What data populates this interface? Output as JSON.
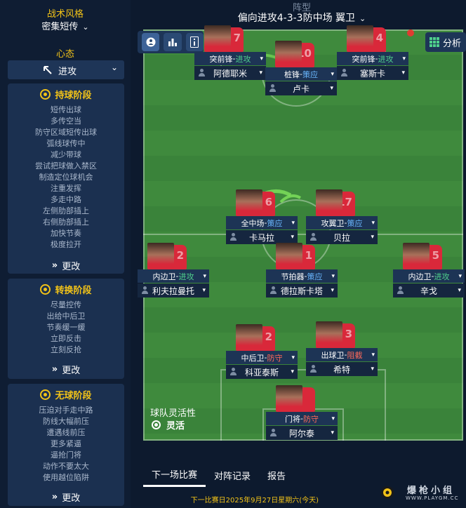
{
  "left_panel": {
    "style_title": "战术风格",
    "style_value": "密集短传",
    "mentality_title": "心态",
    "mentality_value": "进攻",
    "in_possession": {
      "title": "持球阶段",
      "items": [
        "短传出球",
        "多传空当",
        "防守区域短传出球",
        "弧线球传中",
        "减少带球",
        "尝试把球做入禁区",
        "制造定位球机会",
        "注重发挥",
        "多走中路",
        "左侧肋部插上",
        "右侧肋部插上",
        "加快节奏",
        "极度拉开"
      ],
      "button": "更改"
    },
    "transition": {
      "title": "转换阶段",
      "items": [
        "尽量控传",
        "出给中后卫",
        "节奏缓一缓",
        "立即反击",
        "立刻反抢"
      ],
      "button": "更改"
    },
    "out_of_possession": {
      "title": "无球阶段",
      "items": [
        "压迫对手走中路",
        "防线大幅前压",
        "遭遇线前压",
        "更多紧逼",
        "逼抢门将",
        "动作不要太大",
        "使用越位陷阱"
      ],
      "button": "更改"
    }
  },
  "header": {
    "formation_label": "阵型",
    "formation_value": "偏向进攻4-3-3防中场 翼卫"
  },
  "toolbar": {
    "analysis_label": "分析"
  },
  "players": [
    {
      "id": "lf",
      "role": "突前锋",
      "duty": "进攻",
      "duty_type": "attack",
      "name": "阿德耶米",
      "number": "7"
    },
    {
      "id": "cf",
      "role": "桩锋",
      "duty": "策应",
      "duty_type": "support",
      "name": "卢卡",
      "number": "10"
    },
    {
      "id": "rf",
      "role": "突前锋",
      "duty": "进攻",
      "duty_type": "attack",
      "name": "塞斯卡",
      "number": "4"
    },
    {
      "id": "cm",
      "role": "全中场",
      "duty": "策应",
      "duty_type": "support",
      "name": "卡马拉",
      "number": "6"
    },
    {
      "id": "am",
      "role": "攻翼卫",
      "duty": "策应",
      "duty_type": "support",
      "name": "贝拉",
      "number": "17"
    },
    {
      "id": "lb",
      "role": "内边卫",
      "duty": "进攻",
      "duty_type": "attack",
      "name": "利夫拉曼托",
      "number": "2"
    },
    {
      "id": "dm",
      "role": "节拍器",
      "duty": "策应",
      "duty_type": "support",
      "name": "德拉斯卡塔",
      "number": "1"
    },
    {
      "id": "rb",
      "role": "内边卫",
      "duty": "进攻",
      "duty_type": "attack",
      "name": "辛戈",
      "number": "5"
    },
    {
      "id": "lcb",
      "role": "中后卫",
      "duty": "防守",
      "duty_type": "defend",
      "name": "科亚泰斯",
      "number": "2"
    },
    {
      "id": "rcb",
      "role": "出球卫",
      "duty": "阻截",
      "duty_type": "defend",
      "name": "希特",
      "number": "3"
    },
    {
      "id": "gk",
      "role": "门将",
      "duty": "防守",
      "duty_type": "defend",
      "name": "阿尔泰",
      "number": ""
    }
  ],
  "flex": {
    "title": "球队灵活性",
    "value": "灵活"
  },
  "tabs": [
    "下一场比赛",
    "对阵记录",
    "报告"
  ],
  "next_match": "下一比赛日2025年9月27日星期六(今天)",
  "watermark": {
    "text": "爆枪小组",
    "url": "WWW.PLAYGM.CC"
  },
  "colors": {
    "accent": "#f2c318",
    "attack": "#4fd08c",
    "support": "#6ab7ff",
    "defend": "#ff6a5a",
    "pitch": "#3f8a3d"
  }
}
